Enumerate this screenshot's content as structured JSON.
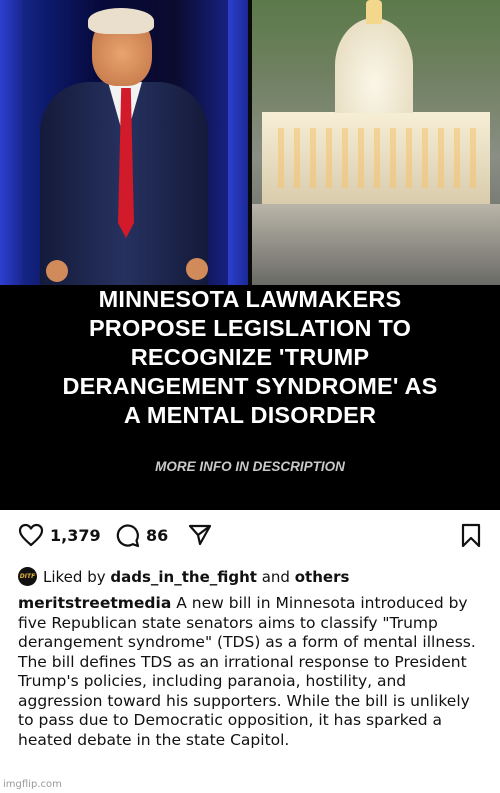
{
  "post": {
    "headline_lines": [
      "MINNESOTA LAWMAKERS",
      "PROPOSE LEGISLATION TO",
      "RECOGNIZE 'TRUMP",
      "DERANGEMENT SYNDROME' AS",
      "A MENTAL DISORDER"
    ],
    "subline": "MORE INFO IN DESCRIPTION"
  },
  "actions": {
    "like_icon": "heart-icon",
    "like_count": "1,379",
    "comment_icon": "comment-bubble-icon",
    "comment_count": "86",
    "share_icon": "paper-plane-icon",
    "save_icon": "bookmark-icon"
  },
  "liked_by": {
    "avatar_initials": "DITF",
    "prefix": "Liked by",
    "user": "dads_in_the_fight",
    "and": "and",
    "others": "others"
  },
  "caption": {
    "username": "meritstreetmedia",
    "text": "A new bill in Minnesota introduced by five Republican state senators aims to classify \"Trump derangement syndrome\" (TDS) as a form of mental illness. The bill defines TDS as an irrational response to President Trump's policies, including paranoia, hostility, and aggression toward his supporters. While the bill is unlikely to pass due to Democratic opposition, it has sparked a heated debate in the state Capitol."
  },
  "watermark": "imgflip.com",
  "colors": {
    "background": "#ffffff",
    "text": "#111111",
    "image_bg": "#000000",
    "subline": "#c9c9c9"
  }
}
